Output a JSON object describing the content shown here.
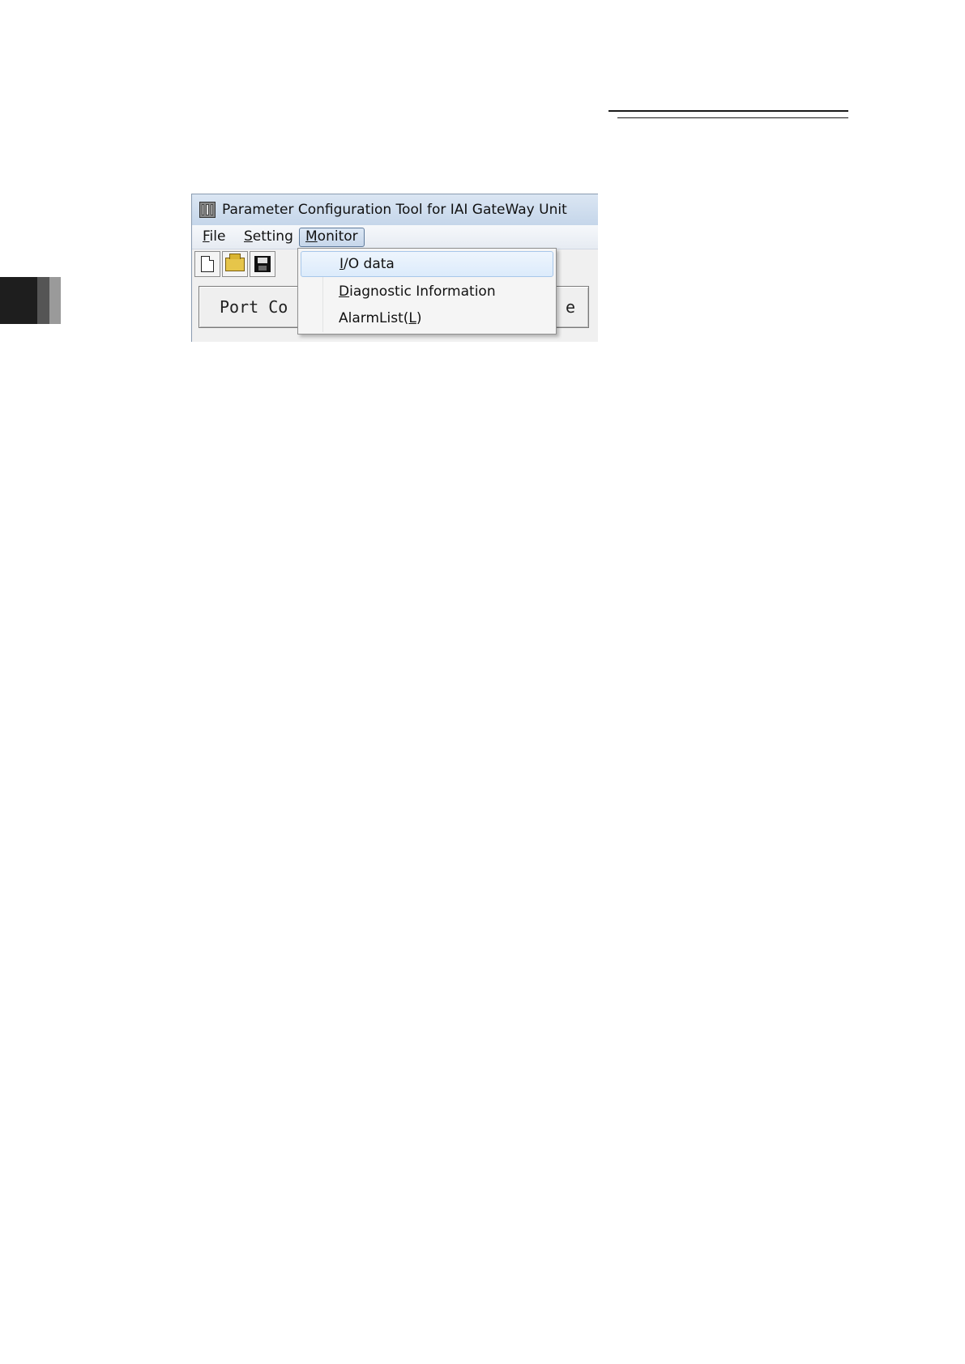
{
  "window": {
    "title": "Parameter Configuration Tool for IAI GateWay Unit",
    "icon": "app-icon"
  },
  "menubar": {
    "items": [
      {
        "label": "File",
        "mnemonic": "F",
        "rest": "ile"
      },
      {
        "label": "Setting",
        "mnemonic": "S",
        "rest": "etting"
      },
      {
        "label": "Monitor",
        "mnemonic": "M",
        "rest": "onitor",
        "active": true
      }
    ]
  },
  "toolbar": {
    "buttons": [
      {
        "icon": "new-file-icon"
      },
      {
        "icon": "open-folder-icon"
      },
      {
        "icon": "save-disk-icon"
      }
    ]
  },
  "main": {
    "port_button_left": "Port Co",
    "port_button_right": "e"
  },
  "monitor_menu": {
    "items": [
      {
        "label": "I/O data",
        "mnemonic": "I",
        "rest": "/O data",
        "highlighted": true
      },
      {
        "label": "Diagnostic Information",
        "mnemonic": "D",
        "rest": "iagnostic Information"
      },
      {
        "label": "AlarmList(L)",
        "prefix": "AlarmList(",
        "mnemonic": "L",
        "suffix": ")"
      }
    ]
  }
}
